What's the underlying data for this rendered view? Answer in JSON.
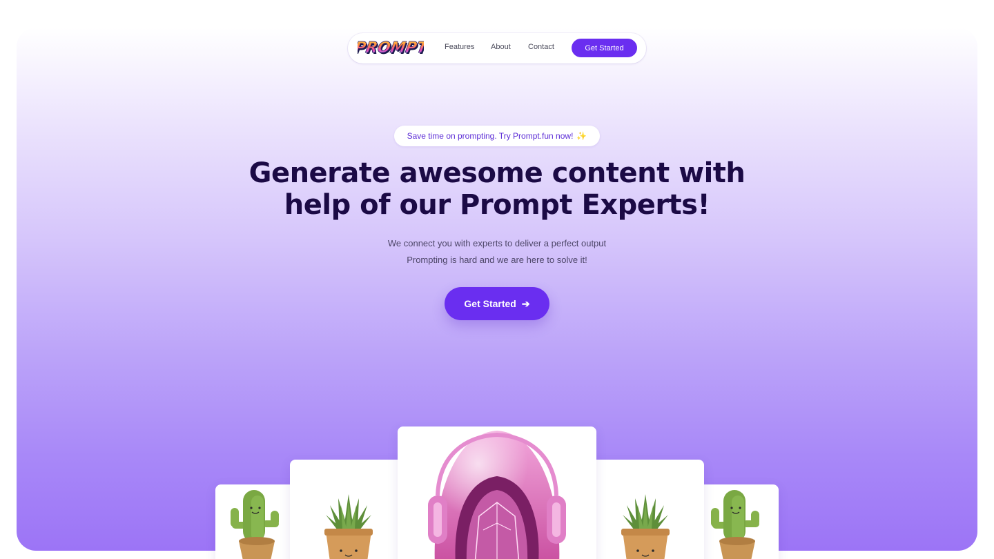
{
  "navbar": {
    "logo_text": "PROMPT",
    "links": [
      "Features",
      "About",
      "Contact"
    ],
    "cta_label": "Get Started"
  },
  "hero": {
    "badge_text": "Save time on prompting. Try Prompt.fun now!",
    "badge_icon": "sparkles-icon",
    "headline_line1": "Generate awesome content with",
    "headline_line2": "help of our Prompt Experts!",
    "subtext_line1": "We connect you with experts to deliver a perfect output",
    "subtext_line2": "Prompting is hard and we are here to solve it!",
    "cta_label": "Get Started",
    "cta_icon": "arrow-right-icon"
  },
  "gallery": [
    {
      "subject": "cactus-in-pot"
    },
    {
      "subject": "succulent-in-pot"
    },
    {
      "subject": "pink-robot-with-headphones"
    },
    {
      "subject": "succulent-in-pot"
    },
    {
      "subject": "cactus-in-pot"
    }
  ],
  "colors": {
    "accent": "#6a2ef0",
    "heading": "#1b0a45",
    "gradient_bottom": "#9c74f6"
  }
}
